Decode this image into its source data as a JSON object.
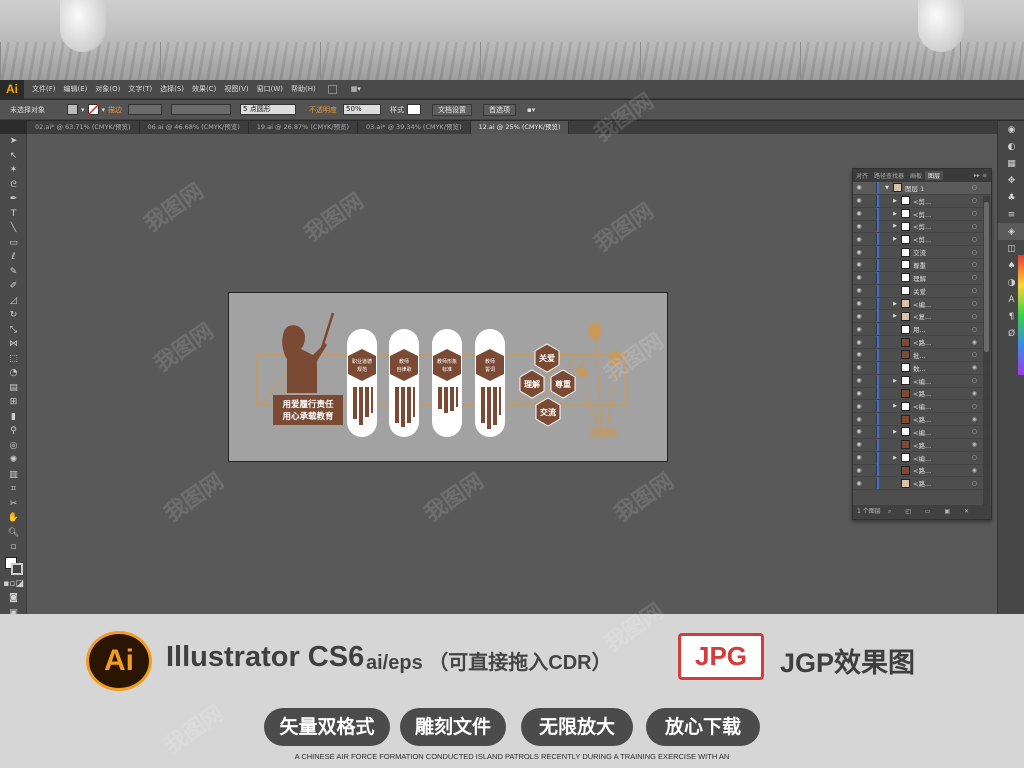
{
  "app": {
    "logo": "Ai"
  },
  "menubar": {
    "items": [
      "文件(F)",
      "编辑(E)",
      "对象(O)",
      "文字(T)",
      "选择(S)",
      "效果(C)",
      "视图(V)",
      "窗口(W)",
      "帮助(H)"
    ]
  },
  "control_bar": {
    "selection": "未选择对象",
    "stroke_label": "描边",
    "brush_value": "5 点圆形",
    "opacity_label": "不透明度",
    "opacity_value": "50%",
    "style_label": "样式",
    "doc_setup": "文档设置",
    "preferences": "首选项"
  },
  "document_tabs": [
    {
      "label": "02.ai* @ 63.71% (CMYK/预览)",
      "active": false
    },
    {
      "label": "06.ai @ 46.68% (CMYK/预览)",
      "active": false
    },
    {
      "label": "19.ai @ 26.87% (CMYK/预览)",
      "active": false
    },
    {
      "label": "03.ai* @ 39.34% (CMYK/预览)",
      "active": false
    },
    {
      "label": "12.ai @ 25% (CMYK/预览)",
      "active": true
    }
  ],
  "artwork": {
    "slogan_line1": "用爱履行责任",
    "slogan_line2": "用心承载教育",
    "pillars": [
      {
        "line1": "职业道德",
        "line2": "规范"
      },
      {
        "line1": "教师",
        "line2": "自律歌"
      },
      {
        "line1": "教师形象",
        "line2": "标准"
      },
      {
        "line1": "教师",
        "line2": "誓词"
      }
    ],
    "hexagons": [
      "关爱",
      "理解",
      "尊重",
      "交流"
    ],
    "colors": {
      "brown": "#7a4a35",
      "gold": "#c99a5a",
      "board": "#a2a2a2"
    }
  },
  "layers_panel": {
    "tabs": [
      {
        "label": "对齐",
        "active": false
      },
      {
        "label": "路径查找器",
        "active": false
      },
      {
        "label": "画板",
        "active": false
      },
      {
        "label": "图层",
        "active": true
      }
    ],
    "layers": [
      {
        "name": "图层 1",
        "expand": "▼",
        "thumb": "mixed"
      },
      {
        "name": "<剪...",
        "expand": "▶",
        "thumb": "white"
      },
      {
        "name": "<剪...",
        "expand": "▶",
        "thumb": "white"
      },
      {
        "name": "<剪...",
        "expand": "▶",
        "thumb": "white"
      },
      {
        "name": "<剪...",
        "expand": "▶",
        "thumb": "white"
      },
      {
        "name": "交流",
        "expand": "",
        "thumb": "white"
      },
      {
        "name": "尊重",
        "expand": "",
        "thumb": "white"
      },
      {
        "name": "理解",
        "expand": "",
        "thumb": "white"
      },
      {
        "name": "关爱",
        "expand": "",
        "thumb": "white"
      },
      {
        "name": "<编...",
        "expand": "▶",
        "thumb": "mixed"
      },
      {
        "name": "<复...",
        "expand": "▶",
        "thumb": "mixed"
      },
      {
        "name": "用...",
        "expand": "",
        "thumb": "white"
      },
      {
        "name": "<路...",
        "expand": "",
        "thumb": "brown"
      },
      {
        "name": "批...",
        "expand": "",
        "thumb": "brown"
      },
      {
        "name": "数...",
        "expand": "",
        "thumb": "white"
      },
      {
        "name": "<编...",
        "expand": "▶",
        "thumb": "white"
      },
      {
        "name": "<路...",
        "expand": "",
        "thumb": "brown"
      },
      {
        "name": "<编...",
        "expand": "▶",
        "thumb": "white"
      },
      {
        "name": "<路...",
        "expand": "",
        "thumb": "brown"
      },
      {
        "name": "<编...",
        "expand": "▶",
        "thumb": "white"
      },
      {
        "name": "<路...",
        "expand": "",
        "thumb": "brown"
      },
      {
        "name": "<编...",
        "expand": "▶",
        "thumb": "white"
      },
      {
        "name": "<路...",
        "expand": "",
        "thumb": "brown"
      },
      {
        "name": "<路...",
        "expand": "",
        "thumb": "mixed"
      }
    ],
    "footer": "1 个图层"
  },
  "promo": {
    "software": "Illustrator CS6",
    "formats": "ai/eps （可直接拖入CDR）",
    "jpg_badge": "JPG",
    "jpg_label": "JGP效果图",
    "features": [
      "矢量双格式",
      "雕刻文件",
      "无限放大",
      "放心下载"
    ],
    "caption": "A CHINESE AIR FORCE FORMATION CONDUCTED ISLAND PATROLS RECENTLY DURING A TRAINING EXERCISE WITH AN"
  },
  "watermark": "我图网"
}
